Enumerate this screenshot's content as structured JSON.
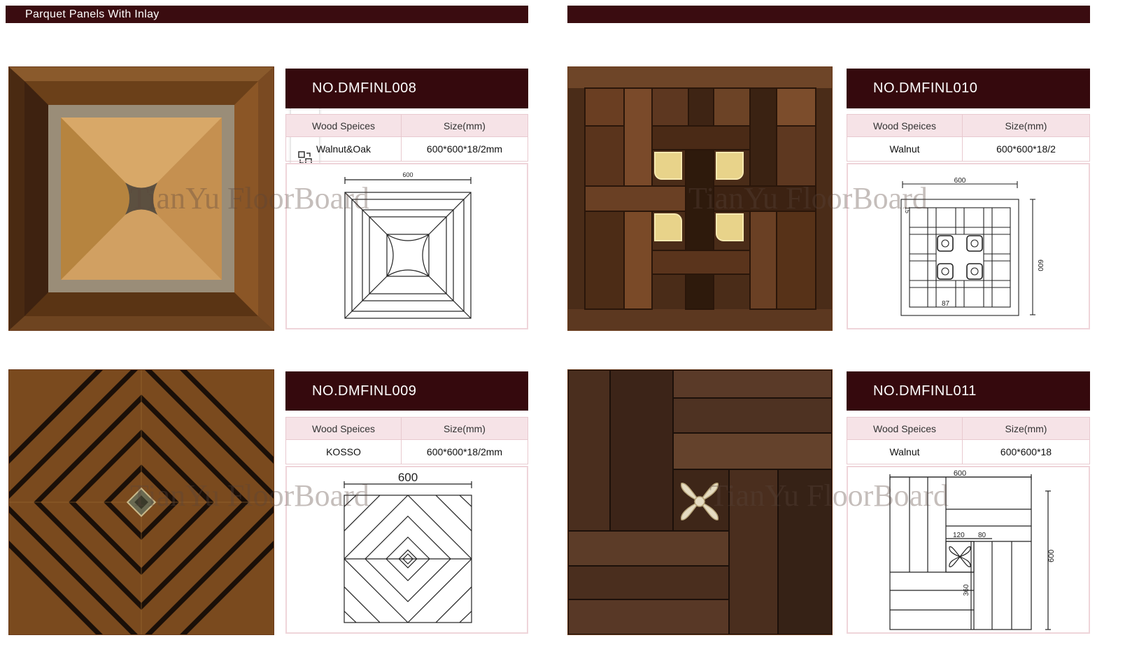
{
  "header": {
    "left_title": "Parquet Panels With Inlay",
    "right_title": ""
  },
  "watermark": "TianYu FloorBoard",
  "spec_headers": {
    "wood": "Wood Speices",
    "size": "Size(mm)"
  },
  "products": [
    {
      "code": "NO.DMFINL008",
      "wood": "Walnut&Oak",
      "size": "600*600*18/2mm",
      "dims": [
        "600"
      ]
    },
    {
      "code": "NO.DMFINL010",
      "wood": "Walnut",
      "size": "600*600*18/2",
      "dims": [
        "600",
        "600",
        "15",
        "87"
      ]
    },
    {
      "code": "NO.DMFINL009",
      "wood": "KOSSO",
      "size": "600*600*18/2mm",
      "dims": [
        "600"
      ]
    },
    {
      "code": "NO.DMFINL011",
      "wood": "Walnut",
      "size": "600*600*18",
      "dims": [
        "600",
        "600",
        "120",
        "80",
        "360"
      ]
    }
  ],
  "toolbar": [
    "image-edit-icon",
    "text-edit-icon",
    "convert-icon",
    "zoom-in-icon",
    "image-enhance-icon",
    "more-icon"
  ],
  "colors": {
    "banner": "#3a0c10",
    "header": "#35090d",
    "spec_bg": "#f6e3e7",
    "border": "#efd5da"
  }
}
